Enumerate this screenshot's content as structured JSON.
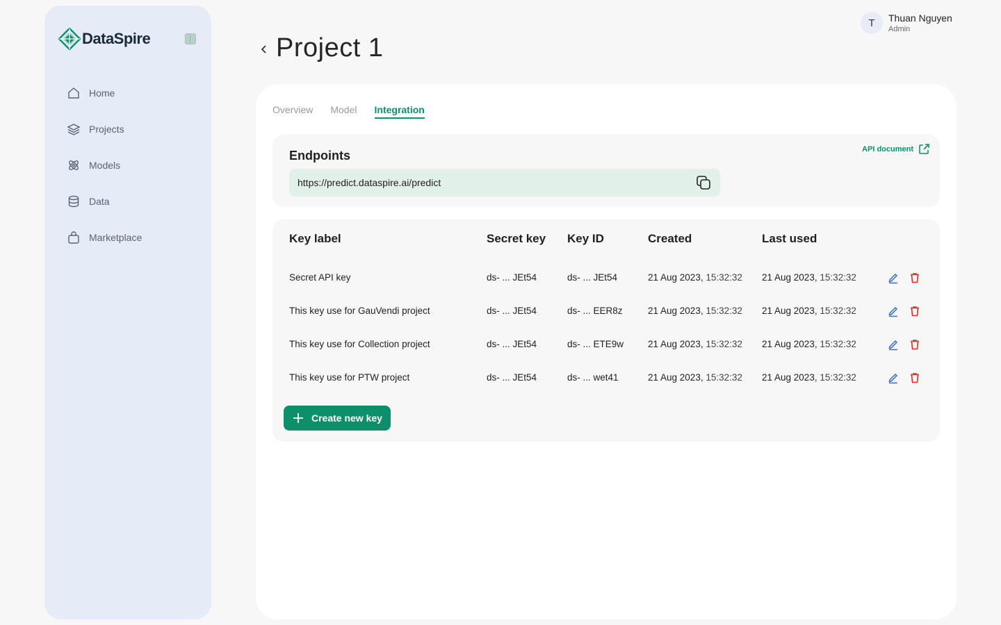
{
  "brand": {
    "name": "DataSpire"
  },
  "sidebar": {
    "items": [
      {
        "label": "Home",
        "icon": "home-icon"
      },
      {
        "label": "Projects",
        "icon": "layers-icon"
      },
      {
        "label": "Models",
        "icon": "atom-icon"
      },
      {
        "label": "Data",
        "icon": "database-icon"
      },
      {
        "label": "Marketplace",
        "icon": "shopping-bag-icon"
      }
    ]
  },
  "header": {
    "title": "Project 1"
  },
  "user": {
    "initial": "T",
    "name": "Thuan Nguyen",
    "role": "Admin"
  },
  "tabs": [
    {
      "label": "Overview",
      "active": false
    },
    {
      "label": "Model",
      "active": false
    },
    {
      "label": "Integration",
      "active": true
    }
  ],
  "endpoints": {
    "title": "Endpoints",
    "api_doc_label": "API document",
    "url": "https://predict.dataspire.ai/predict"
  },
  "keys": {
    "columns": [
      "Key label",
      "Secret key",
      "Key ID",
      "Created",
      "Last used"
    ],
    "rows": [
      {
        "label": "Secret API key",
        "secret": "ds- ... JEt54",
        "key_id": "ds- ... JEt54",
        "created_date": "21 Aug 2023,",
        "created_time": "15:32:32",
        "last_date": "21 Aug 2023,",
        "last_time": "15:32:32"
      },
      {
        "label": "This key use for GauVendi project",
        "secret": "ds- ... JEt54",
        "key_id": "ds- ... EER8z",
        "created_date": "21 Aug 2023,",
        "created_time": "15:32:32",
        "last_date": "21 Aug 2023,",
        "last_time": "15:32:32"
      },
      {
        "label": "This key use for Collection project",
        "secret": "ds- ... JEt54",
        "key_id": "ds- ... ETE9w",
        "created_date": "21 Aug 2023,",
        "created_time": "15:32:32",
        "last_date": "21 Aug 2023,",
        "last_time": "15:32:32"
      },
      {
        "label": "This key use for PTW project",
        "secret": "ds- ... JEt54",
        "key_id": "ds- ... wet41",
        "created_date": "21 Aug 2023,",
        "created_time": "15:32:32",
        "last_date": "21 Aug 2023,",
        "last_time": "15:32:32"
      }
    ],
    "create_label": "Create new key"
  },
  "colors": {
    "accent": "#0d8f6c",
    "sidebar_bg": "#e5ebf7",
    "endpoint_bg": "#e1f1ea",
    "edit": "#2f6fd6",
    "delete": "#d62f2f"
  }
}
